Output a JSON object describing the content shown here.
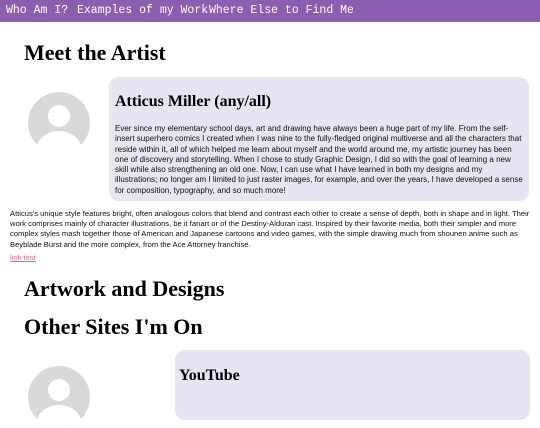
{
  "nav": {
    "items": [
      {
        "label": "Who Am I?"
      },
      {
        "label": "Examples of my Work"
      },
      {
        "label": "Where Else to Find Me"
      }
    ]
  },
  "about": {
    "heading": "Meet the Artist",
    "card": {
      "name": "Atticus Miller (any/all)",
      "bio": "Ever since my elementary school days, art and drawing have always been a huge part of my life. From the self-insert superhero comics I created when I was nine to the fully-fledged original multiverse and all the characters that reside within it, all of which helped me learn about myself and the world around me, my artistic journey has been one of discovery and storytelling. When I chose to study Graphic Design, I did so with the goal of learning a new skill while also strengthening an old one. Now, I can use what I have learned in both my designs and my illustrations; no longer am I limited to just raster images, for example, and over the years, I have developed a sense for composition, typography, and so much more!"
    },
    "paragraph": "Atticus's unique style features bright, often analogous colors that blend and contrast each other to create a sense of depth, both in shape and in light. Their work comprises mainly of character illustrations, be it fanart or of the Destiny-Alduran cast. Inspired by their favorite media, both their simpler and more complex styles mash together those of American and Japanese cartoons and video games, with the simple drawing much from shounen anime such as Beyblade Burst and the more complex, from the Ace Attorney franchise.",
    "link_text": "link test"
  },
  "artwork": {
    "heading": "Artwork and Designs"
  },
  "sites": {
    "heading": "Other Sites I'm On",
    "card": {
      "title": "YouTube"
    }
  },
  "colors": {
    "nav_bg": "#8a5fb0",
    "card_bg": "#e8e4f1",
    "link": "#e8698c",
    "avatar": "#d9d9d9"
  },
  "icons": [
    "default-avatar-icon"
  ]
}
